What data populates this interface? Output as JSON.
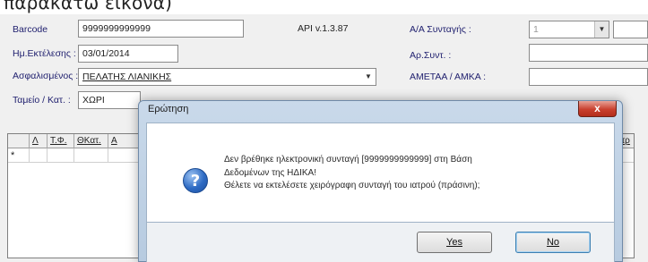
{
  "heading_fragment": "παρακάτω εικόνα)",
  "form": {
    "barcode_label": "Barcode",
    "barcode_value": "9999999999999",
    "api_version": "API v.1.3.87",
    "exec_date_label": "Ημ.Εκτέλεσης :",
    "exec_date_value": "03/01/2014",
    "insured_label": "Ασφαλισμένος :",
    "insured_value": "ΠΕΛΑΤΗΣ ΛΙΑΝΙΚΗΣ",
    "fund_label": "Ταμείο / Κατ. :",
    "fund_value": "ΧΩΡΙ",
    "prescription_no_label": "Α/Α Συνταγής :",
    "prescription_no_value": "1",
    "prescription_num_label": "Αρ.Συντ. :",
    "amka_label": "ΑΜΕΤΑΑ / ΑΜΚΑ :"
  },
  "grid": {
    "headers": [
      "Λ",
      "Τ.Φ.",
      "ΘΚατ.",
      "Α"
    ],
    "right_header": "ιτρ",
    "new_row_marker": "*"
  },
  "dialog": {
    "title": "Ερώτηση",
    "close_label": "x",
    "message_lines": [
      "Δεν βρέθηκε ηλεκτρονική συνταγή [9999999999999] στη Βάση",
      "Δεδομένων της ΗΔΙΚΑ!",
      "Θέλετε να εκτελέσετε χειρόγραφη συνταγή του ιατρού (πράσινη);"
    ],
    "yes_label": "Yes",
    "no_label": "No",
    "icon": "question-icon"
  }
}
